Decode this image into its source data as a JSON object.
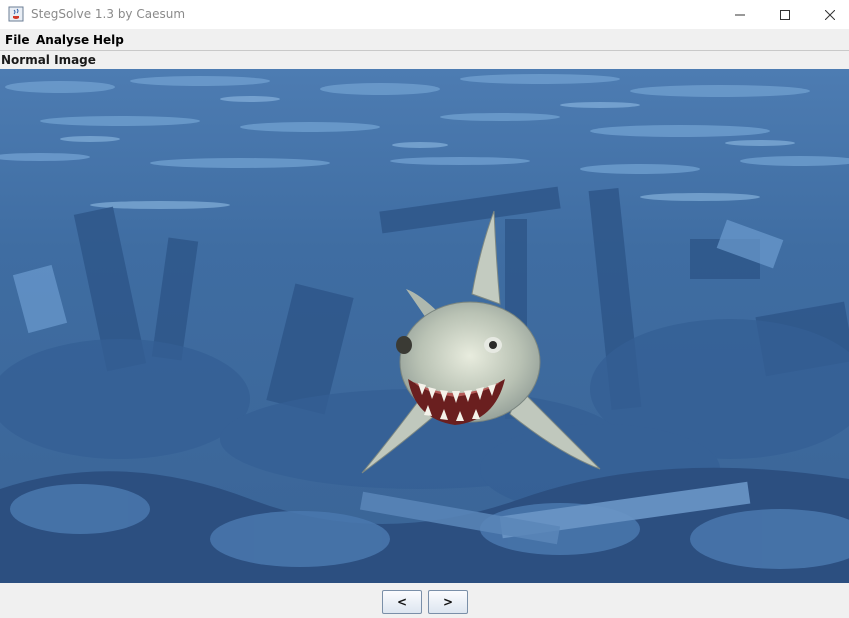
{
  "window": {
    "title": "StegSolve 1.3 by Caesum",
    "app_icon": "java-cup-icon",
    "controls": [
      "minimize-icon",
      "maximize-icon",
      "close-icon"
    ]
  },
  "menu": {
    "items": [
      {
        "label": "File"
      },
      {
        "label": "Analyse"
      },
      {
        "label": "Help"
      }
    ]
  },
  "image_view": {
    "label": "Normal Image",
    "content": "shark-underwater-image"
  },
  "navigation": {
    "prev_label": "<",
    "next_label": ">"
  },
  "colors": {
    "water": "#3e6a9c",
    "water_light": "#6f9fcf",
    "window_bg": "#f0f0f0"
  }
}
